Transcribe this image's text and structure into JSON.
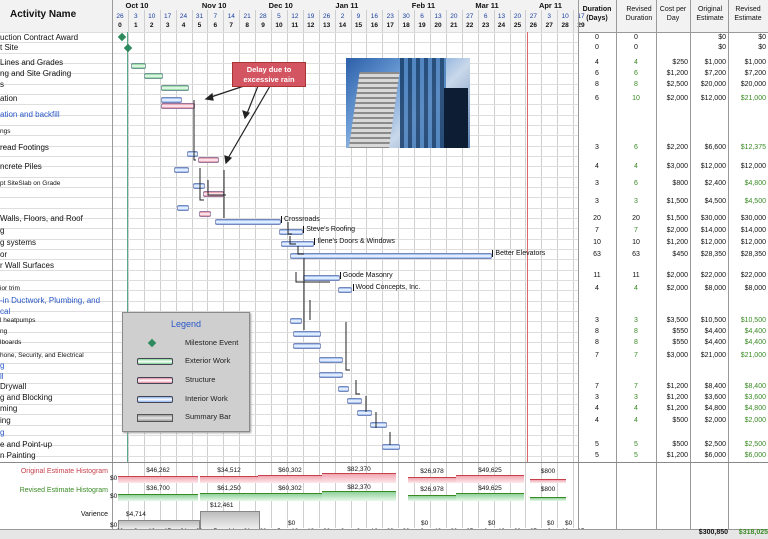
{
  "header": {
    "activity_col": "Activity Name",
    "months": [
      "Oct 10",
      "Nov 10",
      "Dec 10",
      "Jan 11",
      "Feb 11",
      "Mar 11",
      "Apr 11"
    ],
    "week_days": [
      "26",
      "3",
      "10",
      "17",
      "24",
      "31",
      "7",
      "14",
      "21",
      "28",
      "5",
      "12",
      "19",
      "26",
      "2",
      "9",
      "16",
      "23",
      "30",
      "6",
      "13",
      "20",
      "27",
      "6",
      "13",
      "20",
      "27",
      "3",
      "10",
      "17"
    ],
    "week_numbers": [
      "0",
      "1",
      "2",
      "3",
      "4",
      "5",
      "6",
      "7",
      "8",
      "9",
      "10",
      "11",
      "12",
      "13",
      "14",
      "15",
      "16",
      "17",
      "18",
      "19",
      "20",
      "21",
      "22",
      "23",
      "24",
      "25",
      "26",
      "27",
      "28",
      "29"
    ],
    "cols": [
      "Duration (Days)",
      "Revised Duration",
      "Cost per Day",
      "Original Estimate",
      "Revised Estimate"
    ]
  },
  "tasks": [
    {
      "name": "uction Contract Award",
      "style": "normal",
      "dur": "0",
      "rdur": "0",
      "cpd": "",
      "orig": "$0",
      "rev": "$0"
    },
    {
      "name": "t Site",
      "style": "normal",
      "dur": "0",
      "rdur": "0",
      "cpd": "",
      "orig": "$0",
      "rev": "$0"
    },
    {
      "name": "Lines and Grades",
      "style": "normal",
      "dur": "4",
      "rdur": "4",
      "cpd": "$250",
      "orig": "$1,000",
      "rev": "$1,000"
    },
    {
      "name": "ng and Site Grading",
      "style": "normal",
      "dur": "6",
      "rdur": "6",
      "cpd": "$1,200",
      "orig": "$7,200",
      "rev": "$7,200"
    },
    {
      "name": "s",
      "style": "normal",
      "dur": "8",
      "rdur": "8",
      "cpd": "$2,500",
      "orig": "$20,000",
      "rev": "$20,000"
    },
    {
      "name": "ation",
      "style": "normal",
      "dur": "6",
      "rdur": "10",
      "cpd": "$2,000",
      "orig": "$12,000",
      "rev": "$21,000"
    },
    {
      "name": "ation and backfill",
      "style": "blue",
      "dur": "",
      "rdur": "",
      "cpd": "",
      "orig": "",
      "rev": ""
    },
    {
      "name": "ngs",
      "style": "small",
      "dur": "",
      "rdur": "",
      "cpd": "",
      "orig": "",
      "rev": ""
    },
    {
      "name": "read Footings",
      "style": "normal",
      "dur": "3",
      "rdur": "6",
      "cpd": "$2,200",
      "orig": "$6,600",
      "rev": "$12,375"
    },
    {
      "name": "ncrete Piles",
      "style": "normal",
      "dur": "4",
      "rdur": "4",
      "cpd": "$3,000",
      "orig": "$12,000",
      "rev": "$12,000"
    },
    {
      "name": "pt SiteSlab on Grade",
      "style": "small",
      "dur": "3",
      "rdur": "6",
      "cpd": "$800",
      "orig": "$2,400",
      "rev": "$4,800"
    },
    {
      "name": "",
      "style": "normal",
      "dur": "3",
      "rdur": "3",
      "cpd": "$1,500",
      "orig": "$4,500",
      "rev": "$4,500"
    },
    {
      "name": "Walls, Floors, and Roof",
      "style": "normal",
      "dur": "20",
      "rdur": "20",
      "cpd": "$1,500",
      "orig": "$30,000",
      "rev": "$30,000"
    },
    {
      "name": "g",
      "style": "normal",
      "dur": "7",
      "rdur": "7",
      "cpd": "$2,000",
      "orig": "$14,000",
      "rev": "$14,000"
    },
    {
      "name": "g systems",
      "style": "normal",
      "dur": "10",
      "rdur": "10",
      "cpd": "$1,200",
      "orig": "$12,000",
      "rev": "$12,000"
    },
    {
      "name": "or",
      "style": "normal",
      "dur": "63",
      "rdur": "63",
      "cpd": "$450",
      "orig": "$28,350",
      "rev": "$28,350"
    },
    {
      "name": "r Wall Surfaces",
      "style": "normal",
      "dur": "",
      "rdur": "",
      "cpd": "",
      "orig": "",
      "rev": ""
    },
    {
      "name": "",
      "style": "normal",
      "dur": "11",
      "rdur": "11",
      "cpd": "$2,000",
      "orig": "$22,000",
      "rev": "$22,000"
    },
    {
      "name": "ior trim",
      "style": "small",
      "dur": "4",
      "rdur": "4",
      "cpd": "$2,000",
      "orig": "$8,000",
      "rev": "$8,000"
    },
    {
      "name": "-in Ductwork, Plumbing, and",
      "style": "blue",
      "dur": "",
      "rdur": "",
      "cpd": "",
      "orig": "",
      "rev": ""
    },
    {
      "name": "cal",
      "style": "blue",
      "dur": "",
      "rdur": "",
      "cpd": "",
      "orig": "",
      "rev": ""
    },
    {
      "name": "l heatpumps",
      "style": "small",
      "dur": "3",
      "rdur": "3",
      "cpd": "$3,500",
      "orig": "$10,500",
      "rev": "$10,500"
    },
    {
      "name": "ng",
      "style": "small",
      "dur": "8",
      "rdur": "8",
      "cpd": "$550",
      "orig": "$4,400",
      "rev": "$4,400"
    },
    {
      "name": "lboards",
      "style": "small",
      "dur": "8",
      "rdur": "8",
      "cpd": "$550",
      "orig": "$4,400",
      "rev": "$4,400"
    },
    {
      "name": "hone, Security, and Electrical",
      "style": "small",
      "dur": "7",
      "rdur": "7",
      "cpd": "$3,000",
      "orig": "$21,000",
      "rev": "$21,000"
    },
    {
      "name": "g",
      "style": "blue",
      "dur": "",
      "rdur": "",
      "cpd": "",
      "orig": "",
      "rev": ""
    },
    {
      "name": "ll",
      "style": "blue",
      "dur": "",
      "rdur": "",
      "cpd": "",
      "orig": "",
      "rev": ""
    },
    {
      "name": " Drywall",
      "style": "normal",
      "dur": "7",
      "rdur": "7",
      "cpd": "$1,200",
      "orig": "$8,400",
      "rev": "$8,400"
    },
    {
      "name": "g and Blocking",
      "style": "normal",
      "dur": "3",
      "rdur": "3",
      "cpd": "$1,200",
      "orig": "$3,600",
      "rev": "$3,600"
    },
    {
      "name": "ming",
      "style": "normal",
      "dur": "4",
      "rdur": "4",
      "cpd": "$1,200",
      "orig": "$4,800",
      "rev": "$4,800"
    },
    {
      "name": "ing",
      "style": "normal",
      "dur": "4",
      "rdur": "4",
      "cpd": "$500",
      "orig": "$2,000",
      "rev": "$2,000"
    },
    {
      "name": "g",
      "style": "blue",
      "dur": "",
      "rdur": "",
      "cpd": "",
      "orig": "",
      "rev": ""
    },
    {
      "name": "e and Point-up",
      "style": "normal",
      "dur": "5",
      "rdur": "5",
      "cpd": "$500",
      "orig": "$2,500",
      "rev": "$2,500"
    },
    {
      "name": "n Painting",
      "style": "normal",
      "dur": "5",
      "rdur": "5",
      "cpd": "$1,200",
      "orig": "$6,000",
      "rev": "$6,000"
    }
  ],
  "annotation": {
    "text": "Delay due to excessive rain"
  },
  "bar_labels": [
    "Crossroads",
    "Steve's Roofing",
    "Ilene's Doors & Windows",
    "Better Elevators",
    "Goode Masonry",
    "Wood Concepts, Inc."
  ],
  "legend": {
    "title": "Legend",
    "items": [
      "Milestone Event",
      "Exterior Work",
      "Structure",
      "Interior Work",
      "Summary Bar"
    ]
  },
  "histogram": {
    "original_label": "Original Estimate Histogram",
    "revised_label": "Revised Estimate Histogram",
    "variance_label": "Varience",
    "zero": "$0",
    "original_values": [
      "$46,262",
      "$34,512",
      "$60,302",
      "$82,370",
      "$26,978",
      "$49,625",
      "$800"
    ],
    "revised_values": [
      "$36,700",
      "$61,250",
      "$60,302",
      "$82,370",
      "$26,978",
      "$49,625",
      "$800"
    ],
    "variance_values": [
      "$4,714",
      "$12,461",
      "$0",
      "$0",
      "$0",
      "$0",
      "$0"
    ]
  },
  "totals": {
    "original": "$300,850",
    "revised": "$318,025"
  },
  "colors": {
    "exterior": "#7bd48f",
    "structure": "#e58aa0",
    "interior": "#8ab2ee",
    "annotation": "#d9505c",
    "grid": "#cfcfcf"
  },
  "chart_data": {
    "type": "gantt",
    "x_unit": "week",
    "tasks": [
      {
        "task": "Milestone 1",
        "start": 0.6,
        "end": 0.6,
        "kind": "milestone"
      },
      {
        "task": "Milestone 2",
        "start": 1.0,
        "end": 1.0,
        "kind": "milestone"
      },
      {
        "task": "Lines and Grades",
        "start": 1.2,
        "end": 2.0,
        "kind": "exterior"
      },
      {
        "task": "Site Grading",
        "start": 2.0,
        "end": 3.1,
        "kind": "exterior"
      },
      {
        "task": "Row 5",
        "start": 3.1,
        "end": 4.7,
        "kind": "exterior"
      },
      {
        "task": "Excavation",
        "start": 3.1,
        "end": 4.3,
        "kind": "interior"
      },
      {
        "task": "Excavation revised",
        "start": 3.1,
        "end": 5.1,
        "kind": "structure"
      },
      {
        "task": "Spread Footings",
        "start": 4.7,
        "end": 5.3,
        "kind": "interior"
      },
      {
        "task": "Spread Footings revised",
        "start": 5.4,
        "end": 6.6,
        "kind": "structure"
      },
      {
        "task": "Concrete Piles",
        "start": 3.9,
        "end": 4.7,
        "kind": "interior"
      },
      {
        "task": "Slab on Grade",
        "start": 5.1,
        "end": 5.7,
        "kind": "interior"
      },
      {
        "task": "Slab on Grade revised",
        "start": 5.7,
        "end": 6.9,
        "kind": "structure"
      },
      {
        "task": "Row 12",
        "start": 4.1,
        "end": 4.7,
        "kind": "interior"
      },
      {
        "task": "Row 12 revised",
        "start": 5.5,
        "end": 6.1,
        "kind": "structure"
      },
      {
        "task": "Walls, Floors, and Roof",
        "start": 6.5,
        "end": 10.5,
        "kind": "interior",
        "label": "Crossroads"
      },
      {
        "task": "Roofing",
        "start": 10.5,
        "end": 11.9,
        "kind": "interior",
        "label": "Steve's Roofing"
      },
      {
        "task": "Doors and windows",
        "start": 10.6,
        "end": 12.6,
        "kind": "interior",
        "label": "Ilene's Doors & Windows"
      },
      {
        "task": "Elevator",
        "start": 11.2,
        "end": 23.8,
        "kind": "interior",
        "label": "Better Elevators"
      },
      {
        "task": "Masonry",
        "start": 12.0,
        "end": 14.2,
        "kind": "interior",
        "label": "Goode Masonry"
      },
      {
        "task": "Exterior trim",
        "start": 14.2,
        "end": 15.0,
        "kind": "interior",
        "label": "Wood Concepts, Inc."
      },
      {
        "task": "Heatpumps",
        "start": 11.2,
        "end": 11.8,
        "kind": "interior"
      },
      {
        "task": "Ductwork",
        "start": 11.4,
        "end": 13.0,
        "kind": "interior"
      },
      {
        "task": "Switchboards",
        "start": 11.4,
        "end": 13.0,
        "kind": "interior"
      },
      {
        "task": "Phone, Security, Electrical",
        "start": 13.0,
        "end": 14.4,
        "kind": "interior"
      },
      {
        "task": "Drywall",
        "start": 13.0,
        "end": 14.4,
        "kind": "interior"
      },
      {
        "task": "Framing and Blocking",
        "start": 14.2,
        "end": 14.8,
        "kind": "interior"
      },
      {
        "task": "Trimming",
        "start": 14.8,
        "end": 15.6,
        "kind": "interior"
      },
      {
        "task": "Row 31",
        "start": 15.4,
        "end": 16.2,
        "kind": "interior"
      },
      {
        "task": "Patch and Point-up",
        "start": 16.2,
        "end": 17.2,
        "kind": "interior"
      },
      {
        "task": "Painting",
        "start": 17.0,
        "end": 18.0,
        "kind": "interior"
      }
    ]
  }
}
